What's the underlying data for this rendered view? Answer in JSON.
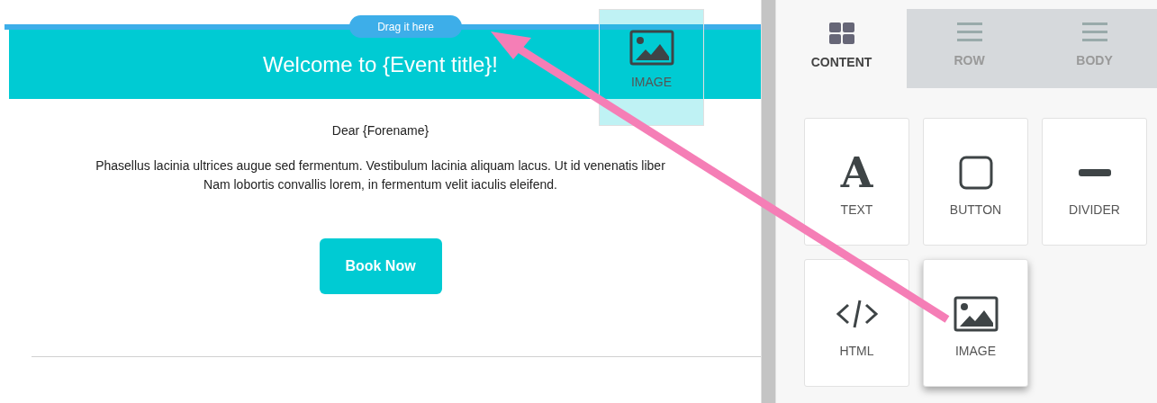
{
  "canvas": {
    "drop_label": "Drag it here",
    "header_title": "Welcome to {Event title}!",
    "greeting": "Dear {Forename}",
    "paragraph_lines": [
      "Phasellus lacinia ultrices augue sed fermentum. Vestibulum lacinia aliquam lacus. Ut id venenatis liber",
      "Nam lobortis convallis lorem, in fermentum velit iaculis eleifend."
    ],
    "cta_button": "Book Now",
    "dragged_tile": {
      "kind": "image",
      "label": "IMAGE"
    }
  },
  "tabs": [
    {
      "kind": "grid",
      "label": "CONTENT",
      "selected": true
    },
    {
      "kind": "lines",
      "label": "ROW",
      "selected": false
    },
    {
      "kind": "lines",
      "label": "BODY",
      "selected": false
    }
  ],
  "blocks": [
    {
      "kind": "text",
      "glyph": "A",
      "label": "TEXT",
      "raised": false
    },
    {
      "kind": "button",
      "label": "BUTTON",
      "raised": false
    },
    {
      "kind": "divider",
      "label": "DIVIDER",
      "raised": false
    },
    {
      "kind": "html",
      "label": "HTML",
      "raised": false
    },
    {
      "kind": "image",
      "label": "IMAGE",
      "raised": true
    }
  ]
}
